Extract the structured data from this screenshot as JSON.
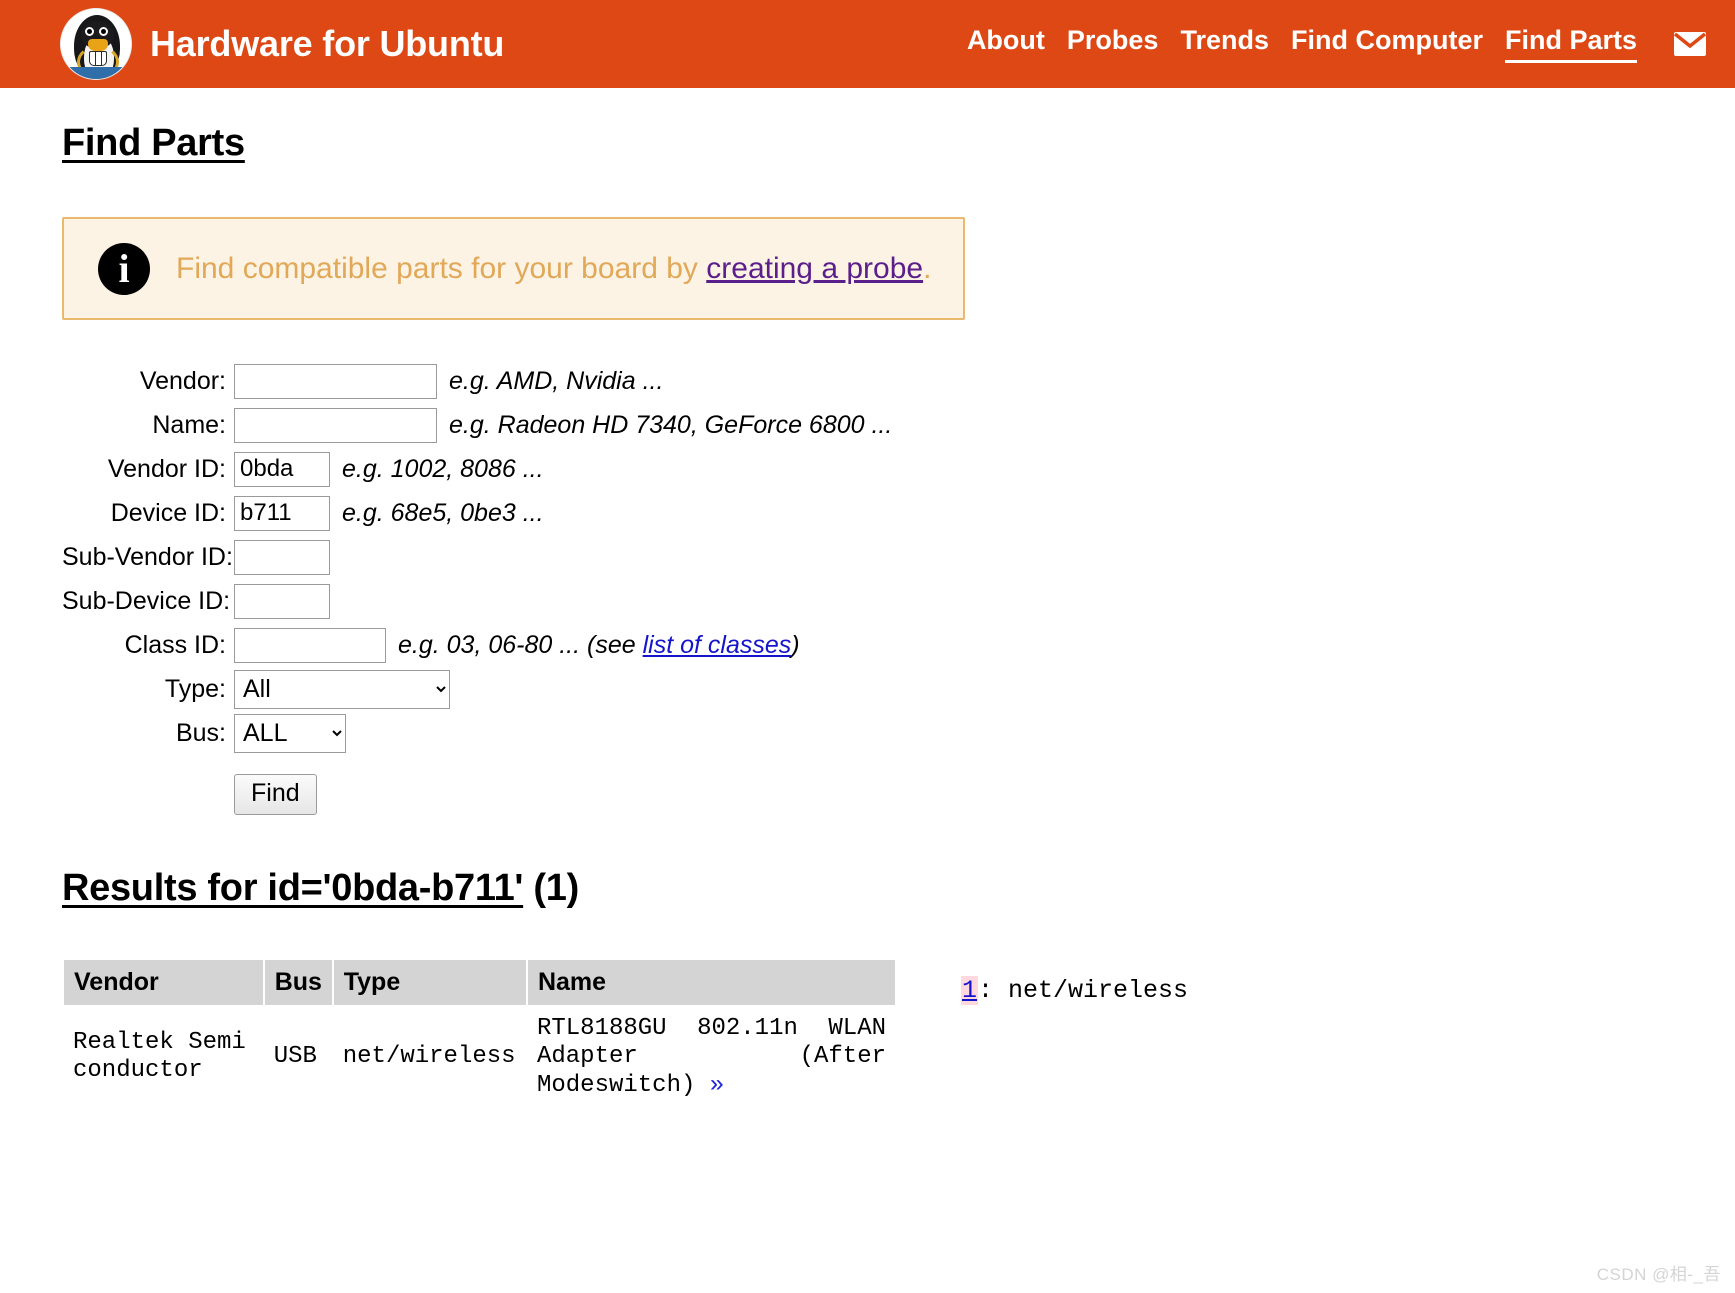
{
  "header": {
    "brand_title": "Hardware for Ubuntu",
    "logo_icon": "penguin-logo-icon",
    "brand_color": "#dd4814",
    "nav": [
      {
        "label": "About",
        "active": false
      },
      {
        "label": "Probes",
        "active": false
      },
      {
        "label": "Trends",
        "active": false
      },
      {
        "label": "Find Computer",
        "active": false
      },
      {
        "label": "Find Parts",
        "active": true
      }
    ],
    "mail_icon": "envelope-icon"
  },
  "page": {
    "title": "Find Parts"
  },
  "notice": {
    "icon": "info-circle-icon",
    "text_before": "Find compatible parts for your board by ",
    "link_text": "creating a probe",
    "text_after": ".",
    "bg_color": "#fdf3e4",
    "border_color": "#e9b96e",
    "text_color": "#e0a857",
    "link_color": "#5b1f8c"
  },
  "form": {
    "fields": {
      "vendor": {
        "label": "Vendor:",
        "value": "",
        "hint": "e.g. AMD, Nvidia ..."
      },
      "name": {
        "label": "Name:",
        "value": "",
        "hint": "e.g. Radeon HD 7340, GeForce 6800 ..."
      },
      "vendor_id": {
        "label": "Vendor ID:",
        "value": "0bda",
        "hint": "e.g. 1002, 8086 ..."
      },
      "device_id": {
        "label": "Device ID:",
        "value": "b711",
        "hint": "e.g. 68e5, 0be3 ..."
      },
      "sub_vendor_id": {
        "label": "Sub-Vendor ID:",
        "value": "",
        "hint": ""
      },
      "sub_device_id": {
        "label": "Sub-Device ID:",
        "value": "",
        "hint": ""
      },
      "class_id": {
        "label": "Class ID:",
        "value": "",
        "hint_before": "e.g. 03, 06-80 ... (see ",
        "hint_link": "list of classes",
        "hint_after": ")"
      },
      "type": {
        "label": "Type:",
        "value": "All"
      },
      "bus": {
        "label": "Bus:",
        "value": "ALL"
      }
    },
    "submit_label": "Find"
  },
  "results": {
    "title_underlined": "Results for id='0bda-b711'",
    "title_count": " (1)",
    "columns": [
      "Vendor",
      "Bus",
      "Type",
      "Name"
    ],
    "rows": [
      {
        "vendor": "Realtek Semiconductor",
        "bus": "USB",
        "type": "net/wireless",
        "name": "RTL8188GU 802.11n WLAN Adapter (After Modeswitch)",
        "name_link_glyph": "»"
      }
    ],
    "legend": [
      {
        "key": "1",
        "separator": ": ",
        "value": "net/wireless"
      }
    ]
  },
  "watermark": "CSDN @相-_吾"
}
